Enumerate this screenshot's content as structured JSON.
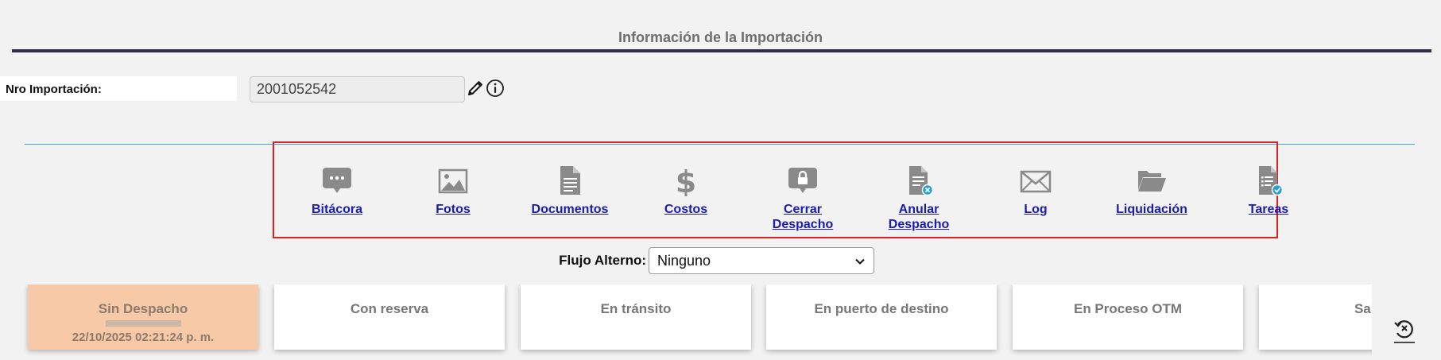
{
  "header": {
    "title": "Información de la Importación"
  },
  "import_number": {
    "label": "Nro Importación:",
    "value": "2001052542"
  },
  "actions": [
    {
      "label_line1": "Bitácora",
      "label_line2": "",
      "icon": "comment-dots-icon"
    },
    {
      "label_line1": "Fotos",
      "label_line2": "",
      "icon": "image-icon"
    },
    {
      "label_line1": "Documentos",
      "label_line2": "",
      "icon": "document-icon"
    },
    {
      "label_line1": "Costos",
      "label_line2": "",
      "icon": "dollar-icon"
    },
    {
      "label_line1": "Cerrar",
      "label_line2": "Despacho",
      "icon": "lock-bubble-icon"
    },
    {
      "label_line1": "Anular",
      "label_line2": "Despacho",
      "icon": "document-cancel-icon"
    },
    {
      "label_line1": "Log",
      "label_line2": "",
      "icon": "envelope-icon"
    },
    {
      "label_line1": "Liquidación",
      "label_line2": "",
      "icon": "folder-open-icon"
    },
    {
      "label_line1": "Tareas",
      "label_line2": "",
      "icon": "task-list-check-icon"
    }
  ],
  "flujo": {
    "label": "Flujo Alterno:",
    "selected": "Ninguno"
  },
  "status_cards": [
    {
      "name": "Sin Despacho",
      "date": "22/10/2025 02:21:24 p. m.",
      "active": true
    },
    {
      "name": "Con reserva",
      "date": "",
      "active": false
    },
    {
      "name": "En tránsito",
      "date": "",
      "active": false
    },
    {
      "name": "En puerto de destino",
      "date": "",
      "active": false
    },
    {
      "name": "En Proceso OTM",
      "date": "",
      "active": false
    },
    {
      "name": "Salida",
      "date": "",
      "active": false
    }
  ],
  "colors": {
    "accent_border": "#e02020",
    "link": "#1a1ab4",
    "active_card": "#f8c9a6",
    "divider": "#39a9c6",
    "title_rule": "#2b2b45"
  }
}
